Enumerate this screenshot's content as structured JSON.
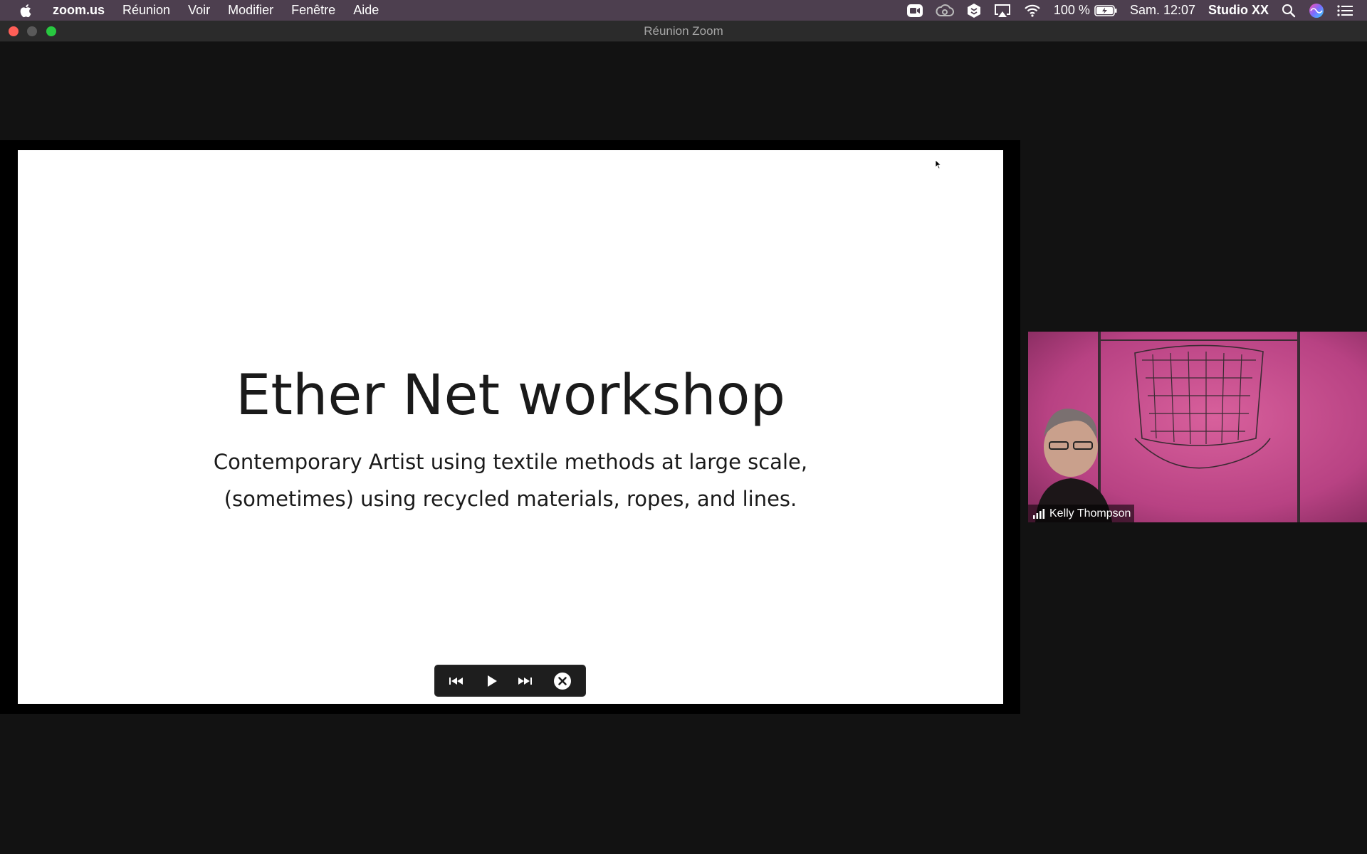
{
  "menubar": {
    "app_name": "zoom.us",
    "items": [
      "Réunion",
      "Voir",
      "Modifier",
      "Fenêtre",
      "Aide"
    ],
    "battery": "100 %",
    "clock": "Sam. 12:07",
    "user": "Studio XX",
    "status_icons": [
      "zoom-icon",
      "creative-cloud-icon",
      "dropbox-icon",
      "airplay-icon",
      "wifi-icon",
      "battery-icon",
      "spotlight-search-icon",
      "siri-icon",
      "notification-center-icon"
    ]
  },
  "window": {
    "title": "Réunion Zoom"
  },
  "slide": {
    "title": "Ether Net workshop",
    "subtitle_line1": "Contemporary Artist using textile methods at large scale,",
    "subtitle_line2": "(sometimes) using recycled materials, ropes, and lines."
  },
  "controls": [
    "previous-slide-icon",
    "play-icon",
    "next-slide-icon",
    "close-icon"
  ],
  "participant": {
    "name": "Kelly Thompson"
  },
  "colors": {
    "menubar_bg": "#4d3f4f",
    "window_bg": "#121212",
    "video_bg": "#c24d8a",
    "close": "#fe5f57",
    "maximize": "#28c840"
  }
}
